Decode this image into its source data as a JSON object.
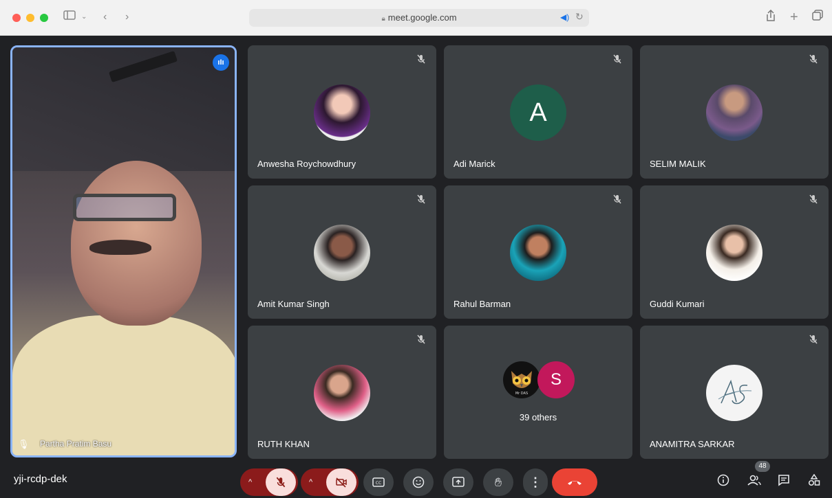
{
  "browser": {
    "url": "meet.google.com",
    "lock_icon": "lock-icon",
    "sound_icon": "speaker-icon"
  },
  "speaker": {
    "name": "Partha Pratim Basu",
    "speaking_icon": "speaking-indicator-icon"
  },
  "tiles": [
    {
      "name": "Anwesha Roychowdhury"
    },
    {
      "name": "Adi Marick",
      "initial": "A",
      "color": "#1e5e4a"
    },
    {
      "name": "SELIM MALIK"
    },
    {
      "name": "Amit Kumar Singh"
    },
    {
      "name": "Rahul Barman"
    },
    {
      "name": "Guddi Kumari"
    },
    {
      "name": "RUTH KHAN"
    },
    {
      "others_label": "39 others",
      "initial": "S",
      "owl_caption": "Mr DAS"
    },
    {
      "name": "ANAMITRA SARKAR",
      "monogram": "AS"
    }
  ],
  "bar": {
    "meeting_code": "yji-rcdp-dek",
    "participant_count": "48"
  },
  "colors": {
    "end_call": "#ea4335",
    "muted_pill": "#8b1b1b",
    "active_border": "#8ab4f8"
  }
}
